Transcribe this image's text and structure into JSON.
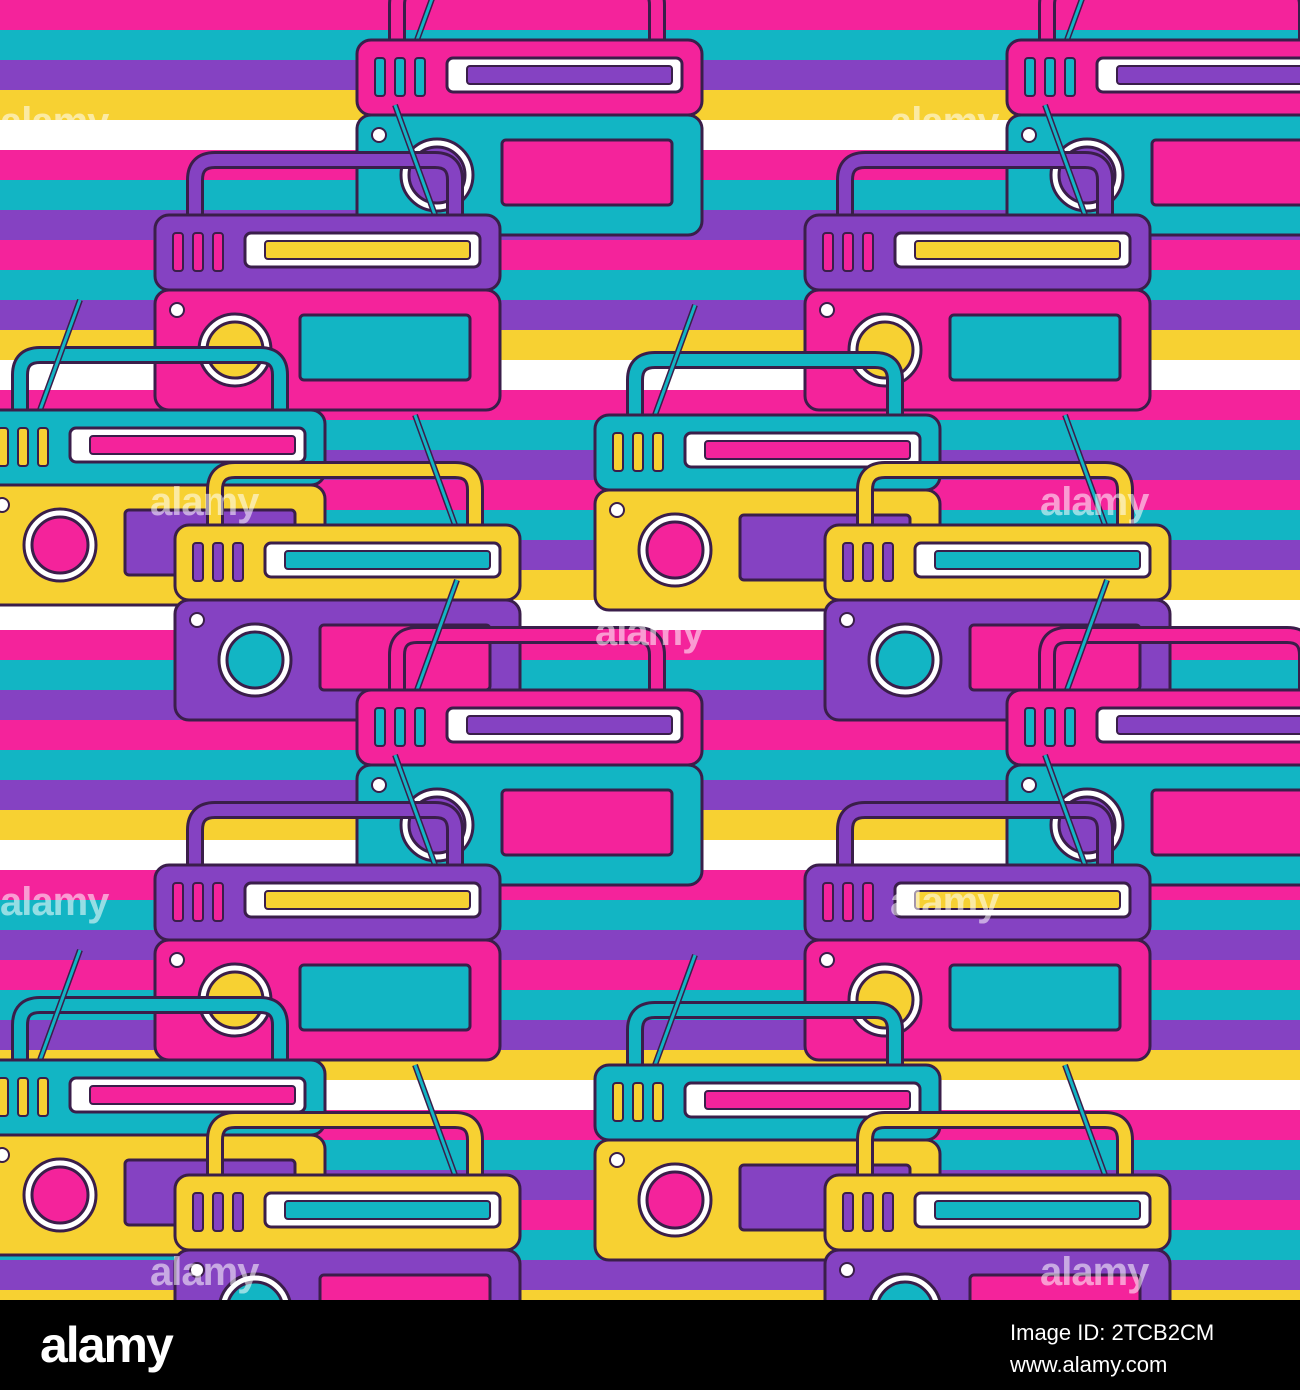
{
  "watermark": {
    "text": "alamy"
  },
  "footer": {
    "logo": "alamy",
    "image_id_line": "Image ID: 2TCB2CM",
    "site": "www.alamy.com"
  },
  "pattern": {
    "description_colors": {
      "pink": "#F4239B",
      "teal": "#12B5C4",
      "purple": "#8542C2",
      "yellow": "#F7D132",
      "white": "#FFFFFF",
      "outline": "#3A1E4A"
    },
    "motif": "radio-icon"
  }
}
